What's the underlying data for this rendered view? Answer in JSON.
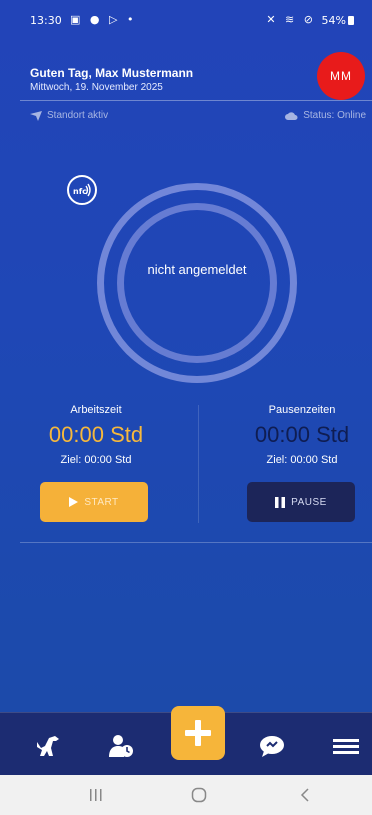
{
  "statusbar": {
    "time": "13:30",
    "left_icons": "▣ ● ▷ •",
    "right_icons": "✕ ≋ ⊘",
    "battery": "54%"
  },
  "header": {
    "greeting": "Guten Tag, Max Mustermann",
    "date": "Mittwoch, 19. November 2025",
    "avatar_initials": "MM",
    "location": "Standort aktiv",
    "status": "Status: Online"
  },
  "tracker": {
    "nfc_label": "NFC",
    "state": "nicht angemeldet"
  },
  "work": {
    "label": "Arbeitszeit",
    "time": "00:00 Std",
    "target": "Ziel: 00:00 Std",
    "button": "START"
  },
  "pause": {
    "label": "Pausenzeiten",
    "time": "00:00 Std",
    "target": "Ziel: 00:00  Std",
    "button": "PAUSE"
  },
  "colors": {
    "accent": "#f6b53a",
    "background": "#1f47b6",
    "avatar": "#e81b1b",
    "nav": "#1c2c72"
  },
  "bottom_nav": {
    "items": [
      "dino-icon",
      "user-clock-icon",
      "plus-icon",
      "chat-icon",
      "menu-icon"
    ]
  }
}
